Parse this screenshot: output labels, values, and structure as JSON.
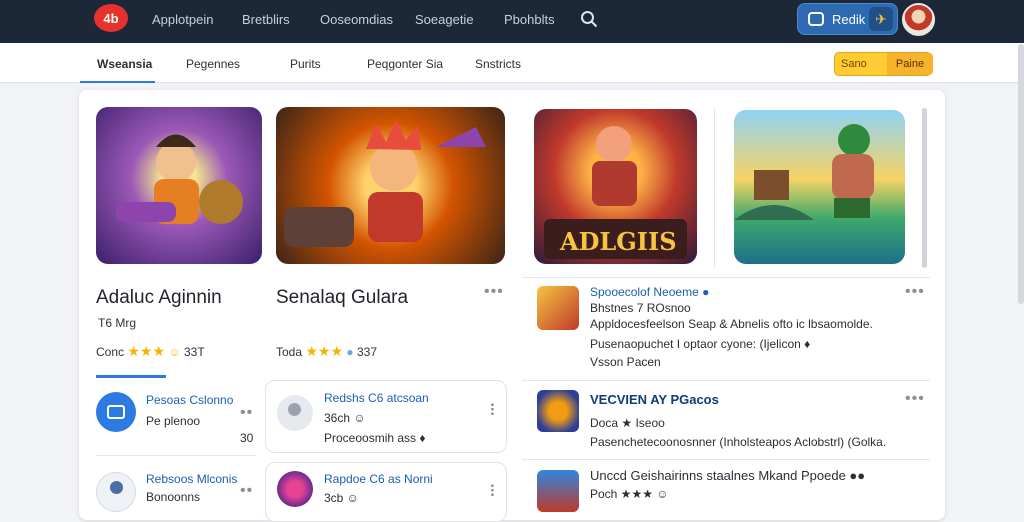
{
  "topbar": {
    "logo": "4b",
    "nav": [
      "Applotpein",
      "Bretblirs",
      "Ooseomdias",
      "Soeagetie",
      "Pbohblts"
    ],
    "action_label": "Redik",
    "action_flag": "✈"
  },
  "tabs": [
    "Wseansia",
    "Pegennes",
    "Purits",
    "Peqgonter Sia",
    "Snstricts"
  ],
  "points": {
    "label": "Sano",
    "value": "Paine"
  },
  "featured": [
    {
      "title": "Adaluc Aginnin",
      "sub": "T6 Mrg",
      "rating_label": "Conc",
      "rating_value": "33T"
    },
    {
      "title": "Senalaq Gulara",
      "sub": "",
      "rating_label": "Toda",
      "rating_value": "337"
    }
  ],
  "banner_text": "ADLGIIS",
  "left_list": [
    {
      "title": "Pesoas Cslonno",
      "sub": "Pe plenoo",
      "count": "30"
    },
    {
      "title": "Rebsoos Mlconis",
      "sub": "Bonoonns",
      "count": ""
    }
  ],
  "middle_list": [
    {
      "title": "Redshs C6 atcsoan",
      "line2": "36ch ☺",
      "line3": "Proceoosmih ass ♦"
    },
    {
      "title": "Rapdoe C6 as Norni",
      "line2": "3cb ☺",
      "line3": ""
    }
  ],
  "right_list": [
    {
      "title": "Spooecolof Neoeme ●",
      "line1": "Bhstnes 7 ROsnoo",
      "line2": "Appldocesfeelson Seap & Abnelis ofto ic lbsaomolde.",
      "line3": "Pusenaopuchet I optaor cyone: (Ijelicon ♦",
      "line4": "Vsson Pacen"
    },
    {
      "title": "VECVIEN AY PGacos",
      "line1": "Doca ★ Iseoo",
      "line2": "Pasenchetecoonosnner (Inholsteapos Aclobstrl) (Golka.",
      "line3": "",
      "line4": ""
    },
    {
      "title": "Unccd Geishairinns staalnes Mkand Ppoede ●●",
      "line1": "Poch ★★★ ☺",
      "line2": "",
      "line3": "",
      "line4": ""
    }
  ],
  "colors": {
    "topbar": "#1c2738",
    "accent": "#2c7be5",
    "points": "#ffcc33"
  }
}
